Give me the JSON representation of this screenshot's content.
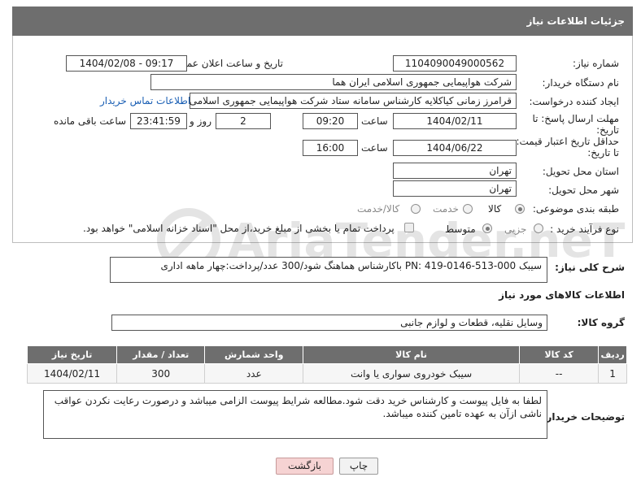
{
  "title": "جزئیات اطلاعات نیاز",
  "fields": {
    "need_number_label": "شماره نیاز:",
    "need_number": "1104090049000562",
    "announce_label": "تاریخ و ساعت اعلان عمومی:",
    "announce_value": "1404/02/08 - 09:17",
    "buyer_label": "نام دستگاه خریدار:",
    "buyer_value": "شرکت هواپیمایی جمهوری اسلامی ایران هما",
    "requester_label": "ایجاد کننده درخواست:",
    "requester_value": "قرامرز زمانی کیاکلایه کارشناس سامانه ستاد شرکت هواپیمایی جمهوری اسلامی ایران هما",
    "contact_link": "اطلاعات تماس خریدار",
    "deadline_label_1": "مهلت ارسال پاسخ: تا",
    "deadline_label_2": "تاریخ:",
    "deadline_date": "1404/02/11",
    "time_label": "ساعت",
    "deadline_time": "09:20",
    "days_value": "2",
    "days_label": "روز و",
    "remaining_time": "23:41:59",
    "remaining_label": "ساعت باقی مانده",
    "validity_label_1": "حداقل تاریخ اعتبار قیمت:",
    "validity_label_2": "تا تاریخ:",
    "validity_date": "1404/06/22",
    "validity_time": "16:00",
    "province_label": "استان محل تحویل:",
    "province_value": "تهران",
    "city_label": "شهر محل تحویل:",
    "city_value": "تهران",
    "category_label": "طبقه بندی موضوعی:",
    "category_options": [
      "کالا",
      "خدمت",
      "کالا/خدمت"
    ],
    "process_label": "نوع فرآیند خرید :",
    "process_options": [
      "جزیی",
      "متوسط"
    ],
    "payment_note": "پرداخت تمام یا بخشی از مبلغ خرید،از محل \"اسناد خزانه اسلامی\" خواهد بود."
  },
  "description": {
    "label": "شرح کلی نیاز:",
    "value": "سیبک PN: 419-0146-513-000 باکارشناس هماهنگ شود/300 عدد/پرداخت:چهار ماهه اداری"
  },
  "goods_section_title": "اطلاعات کالاهای مورد نیاز",
  "goods_group": {
    "label": "گروه کالا:",
    "value": "وسایل نقلیه، قطعات و لوازم جانبی"
  },
  "table": {
    "headers": [
      "ردیف",
      "کد کالا",
      "نام کالا",
      "واحد شمارش",
      "تعداد / مقدار",
      "تاریخ نیاز"
    ],
    "rows": [
      [
        "1",
        "--",
        "سیبک خودروی سواری یا وانت",
        "عدد",
        "300",
        "1404/02/11"
      ]
    ]
  },
  "buyer_notes": {
    "label": "توضیحات خریدار:",
    "value": "لطفا به فایل پیوست و کارشناس خرید دقت شود.مطالعه شرایط پیوست الزامی میباشد و درصورت رعایت نکردن عواقب ناشی ازآن به عهده تامین کننده میباشد."
  },
  "buttons": {
    "print": "چاپ",
    "back": "بازگشت"
  },
  "watermark_text": "AriaTender.neT",
  "colors": {
    "header_bg": "#6e6e6e",
    "link": "#1a5fb4",
    "back_btn": "#f6d3d3"
  }
}
